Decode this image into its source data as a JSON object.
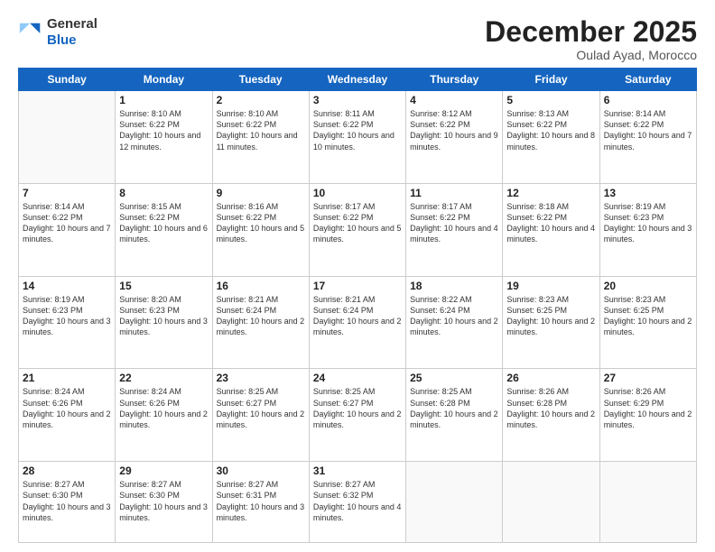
{
  "logo": {
    "general": "General",
    "blue": "Blue"
  },
  "header": {
    "month": "December 2025",
    "location": "Oulad Ayad, Morocco"
  },
  "weekdays": [
    "Sunday",
    "Monday",
    "Tuesday",
    "Wednesday",
    "Thursday",
    "Friday",
    "Saturday"
  ],
  "weeks": [
    [
      {
        "day": "",
        "sunrise": "",
        "sunset": "",
        "daylight": ""
      },
      {
        "day": "1",
        "sunrise": "Sunrise: 8:10 AM",
        "sunset": "Sunset: 6:22 PM",
        "daylight": "Daylight: 10 hours and 12 minutes."
      },
      {
        "day": "2",
        "sunrise": "Sunrise: 8:10 AM",
        "sunset": "Sunset: 6:22 PM",
        "daylight": "Daylight: 10 hours and 11 minutes."
      },
      {
        "day": "3",
        "sunrise": "Sunrise: 8:11 AM",
        "sunset": "Sunset: 6:22 PM",
        "daylight": "Daylight: 10 hours and 10 minutes."
      },
      {
        "day": "4",
        "sunrise": "Sunrise: 8:12 AM",
        "sunset": "Sunset: 6:22 PM",
        "daylight": "Daylight: 10 hours and 9 minutes."
      },
      {
        "day": "5",
        "sunrise": "Sunrise: 8:13 AM",
        "sunset": "Sunset: 6:22 PM",
        "daylight": "Daylight: 10 hours and 8 minutes."
      },
      {
        "day": "6",
        "sunrise": "Sunrise: 8:14 AM",
        "sunset": "Sunset: 6:22 PM",
        "daylight": "Daylight: 10 hours and 7 minutes."
      }
    ],
    [
      {
        "day": "7",
        "sunrise": "Sunrise: 8:14 AM",
        "sunset": "Sunset: 6:22 PM",
        "daylight": "Daylight: 10 hours and 7 minutes."
      },
      {
        "day": "8",
        "sunrise": "Sunrise: 8:15 AM",
        "sunset": "Sunset: 6:22 PM",
        "daylight": "Daylight: 10 hours and 6 minutes."
      },
      {
        "day": "9",
        "sunrise": "Sunrise: 8:16 AM",
        "sunset": "Sunset: 6:22 PM",
        "daylight": "Daylight: 10 hours and 5 minutes."
      },
      {
        "day": "10",
        "sunrise": "Sunrise: 8:17 AM",
        "sunset": "Sunset: 6:22 PM",
        "daylight": "Daylight: 10 hours and 5 minutes."
      },
      {
        "day": "11",
        "sunrise": "Sunrise: 8:17 AM",
        "sunset": "Sunset: 6:22 PM",
        "daylight": "Daylight: 10 hours and 4 minutes."
      },
      {
        "day": "12",
        "sunrise": "Sunrise: 8:18 AM",
        "sunset": "Sunset: 6:22 PM",
        "daylight": "Daylight: 10 hours and 4 minutes."
      },
      {
        "day": "13",
        "sunrise": "Sunrise: 8:19 AM",
        "sunset": "Sunset: 6:23 PM",
        "daylight": "Daylight: 10 hours and 3 minutes."
      }
    ],
    [
      {
        "day": "14",
        "sunrise": "Sunrise: 8:19 AM",
        "sunset": "Sunset: 6:23 PM",
        "daylight": "Daylight: 10 hours and 3 minutes."
      },
      {
        "day": "15",
        "sunrise": "Sunrise: 8:20 AM",
        "sunset": "Sunset: 6:23 PM",
        "daylight": "Daylight: 10 hours and 3 minutes."
      },
      {
        "day": "16",
        "sunrise": "Sunrise: 8:21 AM",
        "sunset": "Sunset: 6:24 PM",
        "daylight": "Daylight: 10 hours and 2 minutes."
      },
      {
        "day": "17",
        "sunrise": "Sunrise: 8:21 AM",
        "sunset": "Sunset: 6:24 PM",
        "daylight": "Daylight: 10 hours and 2 minutes."
      },
      {
        "day": "18",
        "sunrise": "Sunrise: 8:22 AM",
        "sunset": "Sunset: 6:24 PM",
        "daylight": "Daylight: 10 hours and 2 minutes."
      },
      {
        "day": "19",
        "sunrise": "Sunrise: 8:23 AM",
        "sunset": "Sunset: 6:25 PM",
        "daylight": "Daylight: 10 hours and 2 minutes."
      },
      {
        "day": "20",
        "sunrise": "Sunrise: 8:23 AM",
        "sunset": "Sunset: 6:25 PM",
        "daylight": "Daylight: 10 hours and 2 minutes."
      }
    ],
    [
      {
        "day": "21",
        "sunrise": "Sunrise: 8:24 AM",
        "sunset": "Sunset: 6:26 PM",
        "daylight": "Daylight: 10 hours and 2 minutes."
      },
      {
        "day": "22",
        "sunrise": "Sunrise: 8:24 AM",
        "sunset": "Sunset: 6:26 PM",
        "daylight": "Daylight: 10 hours and 2 minutes."
      },
      {
        "day": "23",
        "sunrise": "Sunrise: 8:25 AM",
        "sunset": "Sunset: 6:27 PM",
        "daylight": "Daylight: 10 hours and 2 minutes."
      },
      {
        "day": "24",
        "sunrise": "Sunrise: 8:25 AM",
        "sunset": "Sunset: 6:27 PM",
        "daylight": "Daylight: 10 hours and 2 minutes."
      },
      {
        "day": "25",
        "sunrise": "Sunrise: 8:25 AM",
        "sunset": "Sunset: 6:28 PM",
        "daylight": "Daylight: 10 hours and 2 minutes."
      },
      {
        "day": "26",
        "sunrise": "Sunrise: 8:26 AM",
        "sunset": "Sunset: 6:28 PM",
        "daylight": "Daylight: 10 hours and 2 minutes."
      },
      {
        "day": "27",
        "sunrise": "Sunrise: 8:26 AM",
        "sunset": "Sunset: 6:29 PM",
        "daylight": "Daylight: 10 hours and 2 minutes."
      }
    ],
    [
      {
        "day": "28",
        "sunrise": "Sunrise: 8:27 AM",
        "sunset": "Sunset: 6:30 PM",
        "daylight": "Daylight: 10 hours and 3 minutes."
      },
      {
        "day": "29",
        "sunrise": "Sunrise: 8:27 AM",
        "sunset": "Sunset: 6:30 PM",
        "daylight": "Daylight: 10 hours and 3 minutes."
      },
      {
        "day": "30",
        "sunrise": "Sunrise: 8:27 AM",
        "sunset": "Sunset: 6:31 PM",
        "daylight": "Daylight: 10 hours and 3 minutes."
      },
      {
        "day": "31",
        "sunrise": "Sunrise: 8:27 AM",
        "sunset": "Sunset: 6:32 PM",
        "daylight": "Daylight: 10 hours and 4 minutes."
      },
      {
        "day": "",
        "sunrise": "",
        "sunset": "",
        "daylight": ""
      },
      {
        "day": "",
        "sunrise": "",
        "sunset": "",
        "daylight": ""
      },
      {
        "day": "",
        "sunrise": "",
        "sunset": "",
        "daylight": ""
      }
    ]
  ]
}
